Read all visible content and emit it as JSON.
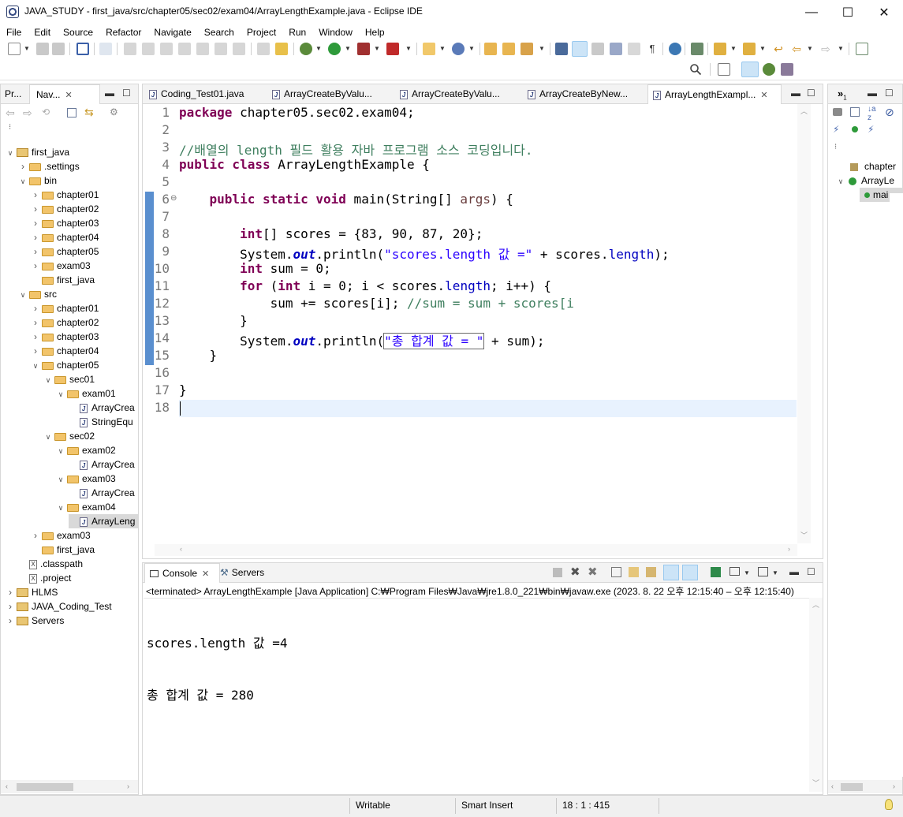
{
  "window": {
    "title": "JAVA_STUDY - first_java/src/chapter05/sec02/exam04/ArrayLengthExample.java - Eclipse IDE",
    "minimize": "—",
    "maximize": "☐",
    "close": "✕"
  },
  "menu": [
    "File",
    "Edit",
    "Source",
    "Refactor",
    "Navigate",
    "Search",
    "Project",
    "Run",
    "Window",
    "Help"
  ],
  "left_panel": {
    "tab1": "Pr...",
    "tab2": "Nav...",
    "tree": [
      {
        "label": "first_java",
        "depth": 0,
        "expanded": true,
        "type": "project"
      },
      {
        "label": ".settings",
        "depth": 1,
        "expanded": false,
        "type": "folder"
      },
      {
        "label": "bin",
        "depth": 1,
        "expanded": true,
        "type": "folder"
      },
      {
        "label": "chapter01",
        "depth": 2,
        "expanded": false,
        "type": "folder"
      },
      {
        "label": "chapter02",
        "depth": 2,
        "expanded": false,
        "type": "folder"
      },
      {
        "label": "chapter03",
        "depth": 2,
        "expanded": false,
        "type": "folder"
      },
      {
        "label": "chapter04",
        "depth": 2,
        "expanded": false,
        "type": "folder"
      },
      {
        "label": "chapter05",
        "depth": 2,
        "expanded": false,
        "type": "folder"
      },
      {
        "label": "exam03",
        "depth": 2,
        "expanded": false,
        "type": "folder"
      },
      {
        "label": "first_java",
        "depth": 2,
        "expanded": null,
        "type": "folder"
      },
      {
        "label": "src",
        "depth": 1,
        "expanded": true,
        "type": "folder"
      },
      {
        "label": "chapter01",
        "depth": 2,
        "expanded": false,
        "type": "folder"
      },
      {
        "label": "chapter02",
        "depth": 2,
        "expanded": false,
        "type": "folder"
      },
      {
        "label": "chapter03",
        "depth": 2,
        "expanded": false,
        "type": "folder"
      },
      {
        "label": "chapter04",
        "depth": 2,
        "expanded": false,
        "type": "folder"
      },
      {
        "label": "chapter05",
        "depth": 2,
        "expanded": true,
        "type": "folder"
      },
      {
        "label": "sec01",
        "depth": 3,
        "expanded": true,
        "type": "folder"
      },
      {
        "label": "exam01",
        "depth": 4,
        "expanded": true,
        "type": "folder"
      },
      {
        "label": "ArrayCrea",
        "depth": 5,
        "expanded": null,
        "type": "java"
      },
      {
        "label": "StringEqu",
        "depth": 5,
        "expanded": null,
        "type": "java"
      },
      {
        "label": "sec02",
        "depth": 3,
        "expanded": true,
        "type": "folder"
      },
      {
        "label": "exam02",
        "depth": 4,
        "expanded": true,
        "type": "folder"
      },
      {
        "label": "ArrayCrea",
        "depth": 5,
        "expanded": null,
        "type": "java"
      },
      {
        "label": "exam03",
        "depth": 4,
        "expanded": true,
        "type": "folder"
      },
      {
        "label": "ArrayCrea",
        "depth": 5,
        "expanded": null,
        "type": "java"
      },
      {
        "label": "exam04",
        "depth": 4,
        "expanded": true,
        "type": "folder"
      },
      {
        "label": "ArrayLeng",
        "depth": 5,
        "expanded": null,
        "type": "java",
        "selected": true
      },
      {
        "label": "exam03",
        "depth": 2,
        "expanded": false,
        "type": "folder"
      },
      {
        "label": "first_java",
        "depth": 2,
        "expanded": null,
        "type": "folder"
      },
      {
        "label": ".classpath",
        "depth": 1,
        "expanded": null,
        "type": "xfile"
      },
      {
        "label": ".project",
        "depth": 1,
        "expanded": null,
        "type": "xfile"
      },
      {
        "label": "HLMS",
        "depth": 0,
        "expanded": false,
        "type": "project"
      },
      {
        "label": "JAVA_Coding_Test",
        "depth": 0,
        "expanded": false,
        "type": "project"
      },
      {
        "label": "Servers",
        "depth": 0,
        "expanded": false,
        "type": "project"
      }
    ]
  },
  "editor": {
    "tabs": [
      "Coding_Test01.java",
      "ArrayCreateByValu...",
      "ArrayCreateByValu...",
      "ArrayCreateByNew...",
      "ArrayLengthExampl..."
    ],
    "active_tab_index": 4,
    "line_numbers": [
      "1",
      "2",
      "3",
      "4",
      "5",
      "6",
      "7",
      "8",
      "9",
      "10",
      "11",
      "12",
      "13",
      "14",
      "15",
      "16",
      "17",
      "18"
    ],
    "code": {
      "l1_kw": "package",
      "l1_rest": " chapter05.sec02.exam04;",
      "l3_comment": "//배열의 length 필드 활용 자바 프로그램 소스 코딩입니다.",
      "l4_kw": "public class",
      "l4_rest": " ArrayLengthExample {",
      "l6_kw": "public static void",
      "l6_mid": " main(String[] ",
      "l6_param": "args",
      "l6_end": ") {",
      "l8_kw": "int",
      "l8_rest": "[] scores = {83, 90, 87, 20};",
      "l9_a": "System.",
      "l9_out": "out",
      "l9_b": ".println(",
      "l9_str": "\"scores.length 값 =\"",
      "l9_c": " + scores.",
      "l9_fld": "length",
      "l9_d": ");",
      "l10_kw": "int",
      "l10_rest": " sum = 0;",
      "l11_kw": "for",
      "l11_a": " (",
      "l11_kw2": "int",
      "l11_b": " i = 0; i < scores.",
      "l11_fld": "length",
      "l11_c": "; i++) {",
      "l12_a": "sum += scores[i]; ",
      "l12_cmt": "//sum = sum + scores[i",
      "l13": "}",
      "l14_a": "System.",
      "l14_out": "out",
      "l14_b": ".println(",
      "l14_str": "\"총 합계 값 = \"",
      "l14_c": " + sum);",
      "l15": "}",
      "l17": "}"
    }
  },
  "outline_panel": {
    "tab": "»",
    "tab_count": "1",
    "items": [
      "chapter",
      "ArrayLe",
      "mai"
    ]
  },
  "console": {
    "tab1": "Console",
    "tab2": "Servers",
    "status": "<terminated> ArrayLengthExample [Java Application] C:₩Program Files₩Java₩jre1.8.0_221₩bin₩javaw.exe  (2023. 8. 22 오후 12:15:40 – 오후 12:15:40)",
    "output": [
      "scores.length 값 =4",
      "총 합계 값 = 280"
    ]
  },
  "statusbar": {
    "mode": "Writable",
    "insert": "Smart Insert",
    "position": "18 : 1 : 415"
  }
}
